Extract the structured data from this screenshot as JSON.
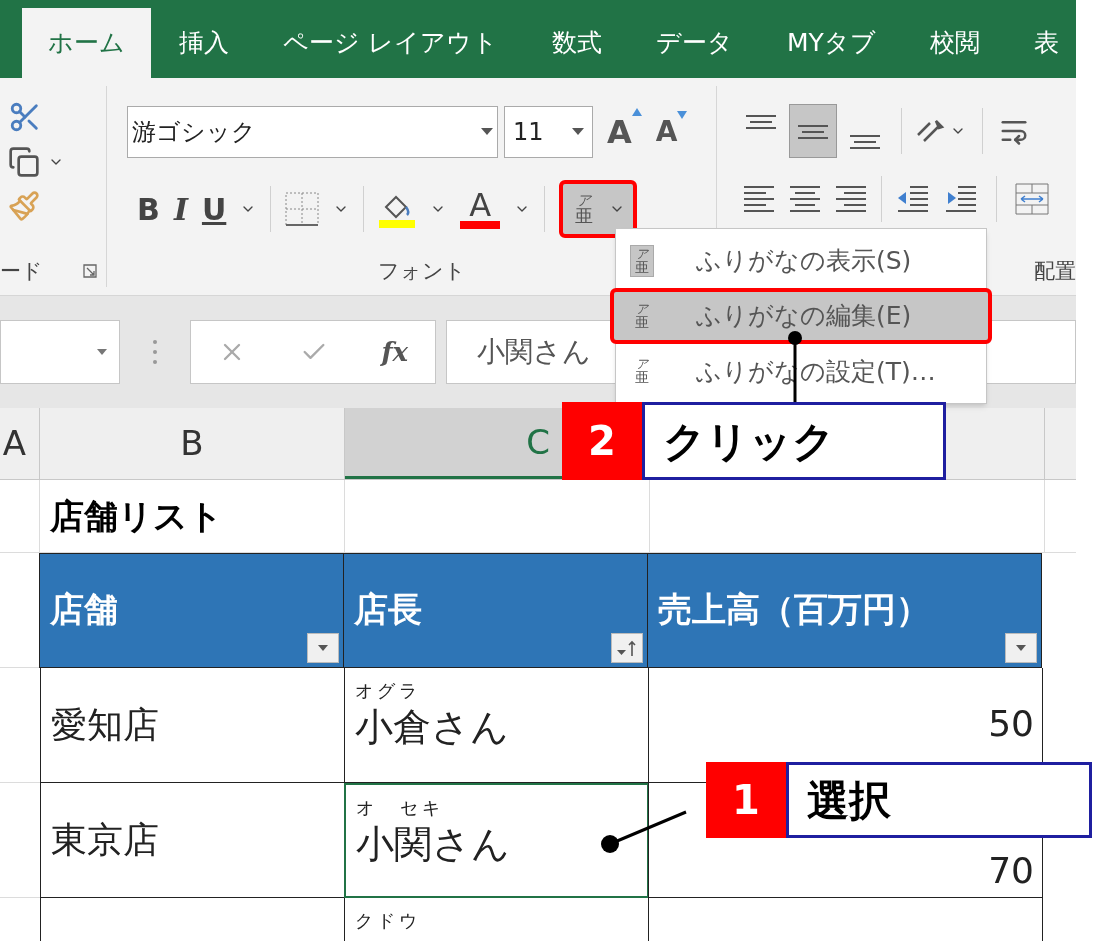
{
  "tabs": [
    {
      "label": "ホーム",
      "selected": true
    },
    {
      "label": "挿入",
      "selected": false
    },
    {
      "label": "ページ レイアウト",
      "selected": false
    },
    {
      "label": "数式",
      "selected": false
    },
    {
      "label": "データ",
      "selected": false
    },
    {
      "label": "MYタブ",
      "selected": false
    },
    {
      "label": "校閲",
      "selected": false
    },
    {
      "label": "表",
      "selected": false
    }
  ],
  "ribbon": {
    "clipboard": {
      "label": "ード"
    },
    "font": {
      "label": "フォント",
      "font_name": "游ゴシック",
      "font_size": "11",
      "grow": "A",
      "shrink": "A",
      "bold": "B",
      "italic": "I",
      "underline": "U",
      "font_color": "A",
      "phonetic": {
        "top": "ア",
        "bottom": "亜",
        "highlighted": true
      }
    },
    "alignment": {
      "label": "配置",
      "middle_selected": true
    }
  },
  "furigana_menu": {
    "items": [
      {
        "icon_top": "ア",
        "icon_bottom": "亜",
        "label": "ふりがなの表示(S)",
        "checked": true,
        "selected": false
      },
      {
        "icon_top": "ア",
        "icon_bottom": "亜",
        "label": "ふりがなの編集(E)",
        "checked": false,
        "selected": true
      },
      {
        "icon_top": "ア",
        "icon_bottom": "亜",
        "label": "ふりがなの設定(T)…",
        "checked": false,
        "selected": false
      }
    ]
  },
  "formula_bar": {
    "fx": "fx",
    "value": "小関さん"
  },
  "columns": [
    {
      "label": "A",
      "selected": false
    },
    {
      "label": "B",
      "selected": false
    },
    {
      "label": "C",
      "selected": true
    }
  ],
  "sheet": {
    "title": "店舗リスト",
    "headers": [
      {
        "label": "店舗",
        "sorted": false
      },
      {
        "label": "店長",
        "sorted": true
      },
      {
        "label": "売上高（百万円）",
        "sorted": false
      }
    ],
    "rows": [
      {
        "store": "愛知店",
        "furigana": "オグラ",
        "manager": "小倉さん",
        "sales": "50",
        "selected": false
      },
      {
        "store": "東京店",
        "furigana": "オ　セキ",
        "manager": "小関さん",
        "sales": "70",
        "selected": true
      },
      {
        "furigana": "クドウ",
        "selected": false
      }
    ]
  },
  "callouts": [
    {
      "number": "2",
      "text": "クリック"
    },
    {
      "number": "1",
      "text": "選択"
    }
  ]
}
